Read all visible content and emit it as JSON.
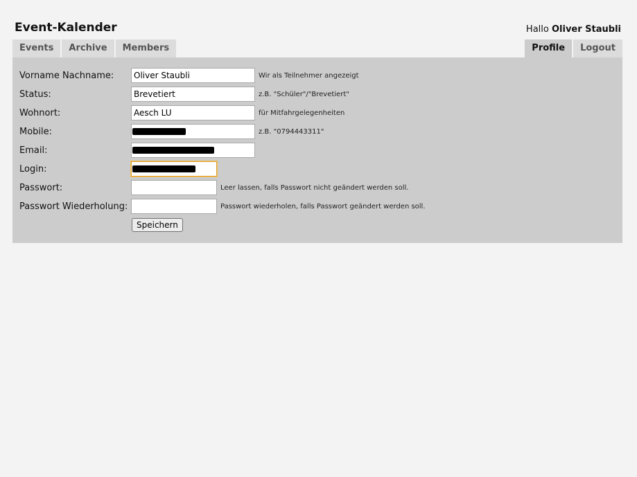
{
  "header": {
    "title": "Event-Kalender",
    "greeting_prefix": "Hallo",
    "username": "Oliver Staubli"
  },
  "nav": {
    "left_tabs": [
      {
        "label": "Events"
      },
      {
        "label": "Archive"
      },
      {
        "label": "Members"
      }
    ],
    "right_tabs": [
      {
        "label": "Profile",
        "active": true
      },
      {
        "label": "Logout"
      }
    ]
  },
  "form": {
    "fields": [
      {
        "label": "Vorname Nachname:",
        "value": "Oliver Staubli",
        "hint": "Wir als Teilnehmer angezeigt"
      },
      {
        "label": "Status:",
        "value": "Brevetiert",
        "hint": "z.B. \"Schüler\"/\"Brevetiert\""
      },
      {
        "label": "Wohnort:",
        "value": "Aesch LU",
        "hint": "für Mitfahrgelegenheiten"
      },
      {
        "label": "Mobile:",
        "value": "",
        "hint": "z.B. \"0794443311\""
      },
      {
        "label": "Email:",
        "value": "",
        "hint": ""
      },
      {
        "label": "Login:",
        "value": "",
        "hint": ""
      },
      {
        "label": "Passwort:",
        "value": "",
        "hint": "Leer lassen, falls Passwort nicht geändert werden soll."
      },
      {
        "label": "Passwort Wiederholung:",
        "value": "",
        "hint": "Passwort wiederholen, falls Passwort geändert werden soll."
      }
    ],
    "save_label": "Speichern"
  },
  "colors": {
    "page_background": "#f3f3f3",
    "panel_background": "#cccccc",
    "tab_background": "#dcdcdc",
    "focus_border": "#e0a030"
  }
}
